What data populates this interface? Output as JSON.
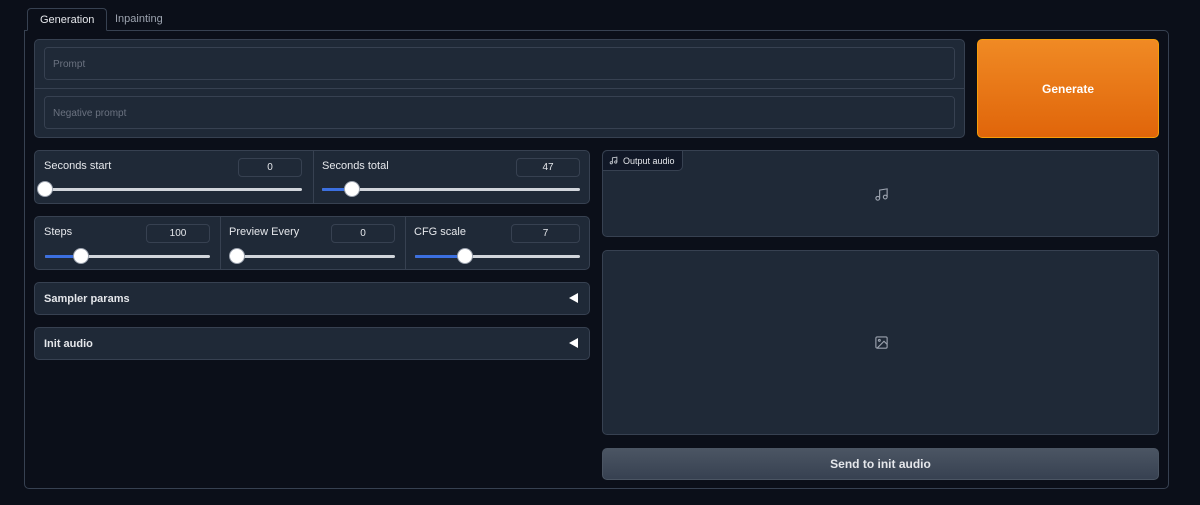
{
  "tabs": [
    {
      "label": "Generation",
      "active": true
    },
    {
      "label": "Inpainting",
      "active": false
    }
  ],
  "prompt": {
    "placeholder": "Prompt",
    "value": ""
  },
  "negative_prompt": {
    "placeholder": "Negative prompt",
    "value": ""
  },
  "generate_label": "Generate",
  "seconds_start": {
    "label": "Seconds start",
    "value": "0",
    "fraction": 0.0
  },
  "seconds_total": {
    "label": "Seconds total",
    "value": "47",
    "fraction": 0.118
  },
  "steps": {
    "label": "Steps",
    "value": "100",
    "fraction": 0.22
  },
  "preview_every": {
    "label": "Preview Every",
    "value": "0",
    "fraction": 0.0
  },
  "cfg_scale": {
    "label": "CFG scale",
    "value": "7",
    "fraction": 0.3
  },
  "accordions": {
    "sampler_params": "Sampler params",
    "init_audio": "Init audio"
  },
  "output_audio": {
    "label": "Output audio",
    "icon": "music-note-icon"
  },
  "output_image": {
    "icon": "image-icon"
  },
  "send_to_init_audio_label": "Send to init audio",
  "colors": {
    "background": "#0b0f19",
    "panel": "#1f2937",
    "border": "#374151",
    "accent_orange": "#e0650a",
    "slider_fill": "#3b6fe0"
  }
}
